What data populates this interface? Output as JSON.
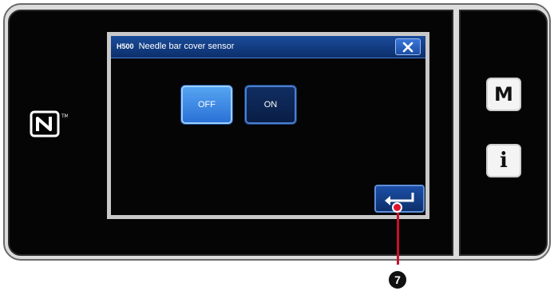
{
  "dialog": {
    "code": "H500",
    "title": "Needle bar cover sensor",
    "close_icon": "close-icon"
  },
  "toggles": {
    "off_label": "OFF",
    "on_label": "ON",
    "selected": "OFF"
  },
  "buttons": {
    "enter_icon": "enter-icon",
    "menu_label": "M",
    "info_label": "i"
  },
  "icons": {
    "nfc": "nfc-icon"
  },
  "callout": {
    "number": "7"
  },
  "colors": {
    "title_bar": "#0c2f6c",
    "selected_toggle": "#3b8ae6",
    "callout_red": "#c8102e"
  }
}
